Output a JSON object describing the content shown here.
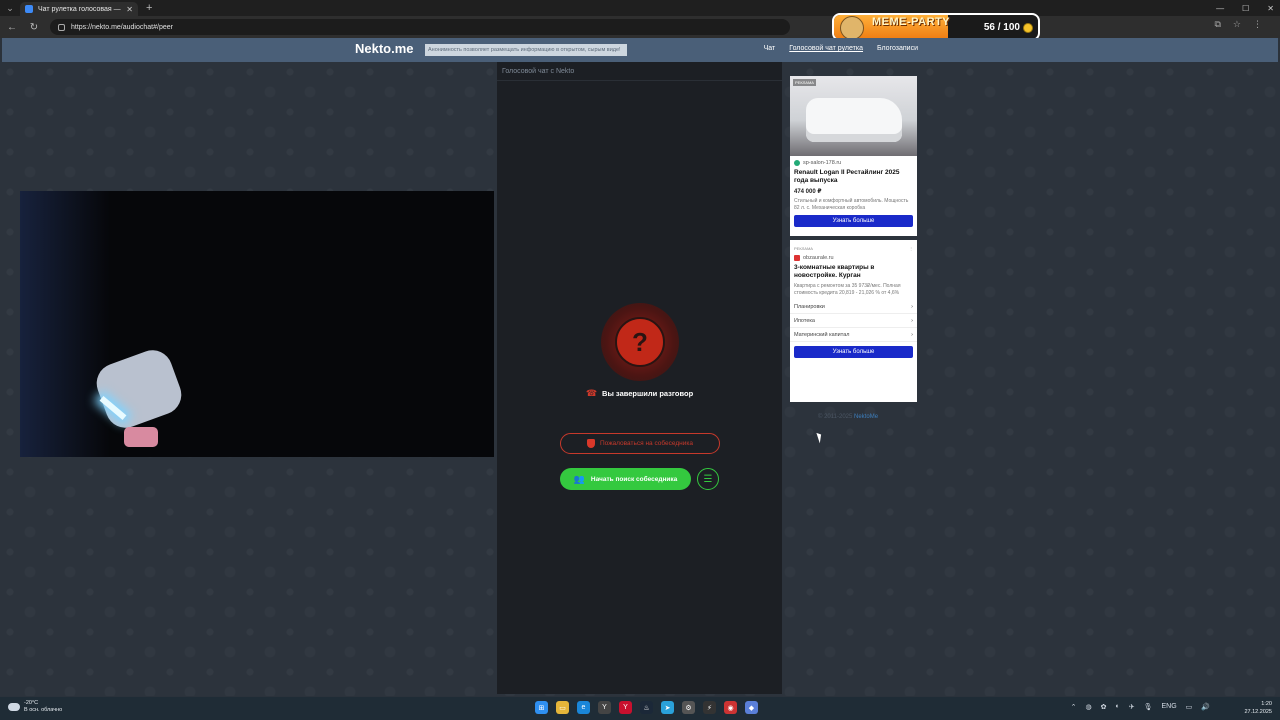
{
  "browser": {
    "tab_title": "Чат рулетка голосовая — Nekto.me",
    "url": "https://nekto.me/audiochat#/peer"
  },
  "extension": {
    "title": "MEME-PARTY",
    "progress_text": "56 / 100",
    "progress_fraction": 0.56
  },
  "site": {
    "logo": "Nekto.me",
    "tagline": "Анонимность позволяет размещать информацию в открытом, сырым виде!",
    "menu": [
      {
        "label": "Чат"
      },
      {
        "label": "Голосовой чат рулетка"
      },
      {
        "label": "Блогозаписи"
      }
    ]
  },
  "chat": {
    "panel_title": "Голосовой чат с Nekto",
    "status_icon": "?",
    "status_text": "Вы завершили разговор",
    "report_label": "Пожаловаться на собеседника",
    "search_label": "Начать поиск собеседника"
  },
  "ads": {
    "ad1": {
      "badge": "РЕКЛАМА",
      "source": "sp-salon-178.ru",
      "headline": "Renault Logan II Рестайлинг 2025 года выпуска",
      "price": "474 000 ₽",
      "description": "Стильный и комфортный автомобиль. Мощность 82 л. с. Механическая коробка",
      "cta": "Узнать больше"
    },
    "ad2": {
      "badge": "РЕКЛАМА",
      "source": "obzaurale.ru",
      "headline": "3-комнатные квартиры в новостройке. Курган",
      "description": "Квартира с ремонтом за 35 973₽/мес. Полная стоимость кредита 20,819 - 21,026 % от 4,6%",
      "rows": [
        {
          "label": "Планировки"
        },
        {
          "label": "Ипотека"
        },
        {
          "label": "Материнский капитал"
        }
      ],
      "cta": "Узнать больше"
    }
  },
  "footer": {
    "copyright": "© 2011-2025",
    "link": "NektoMe"
  },
  "taskbar": {
    "weather_temp": "-20°C",
    "weather_desc": "В осн. облачно",
    "lang": "ENG",
    "time": "1:20",
    "date": "27.12.2025"
  }
}
